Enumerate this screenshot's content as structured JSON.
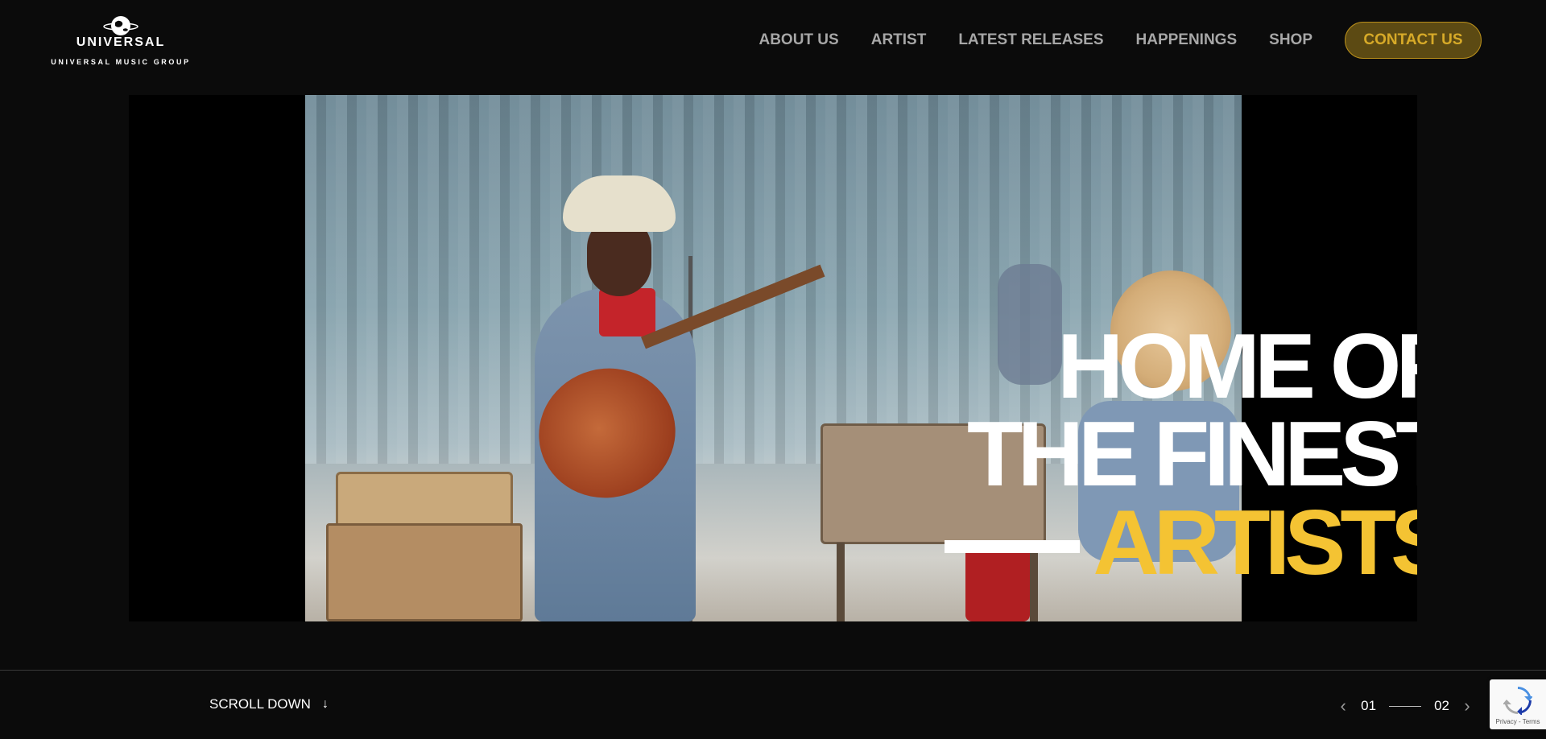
{
  "brand": {
    "logo_word": "UNIVERSAL",
    "logo_sub": "UNIVERSAL MUSIC GROUP",
    "logo_icon": "globe-icon"
  },
  "nav": {
    "items": [
      {
        "label": "ABOUT US"
      },
      {
        "label": "ARTIST"
      },
      {
        "label": "LATEST RELEASES"
      },
      {
        "label": "HAPPENINGS"
      },
      {
        "label": "SHOP"
      }
    ],
    "contact_label": "CONTACT US"
  },
  "hero": {
    "line1": "HOME OF",
    "line2": "THE FINEST",
    "line3": "ARTISTS"
  },
  "footer": {
    "scroll_label": "SCROLL DOWN",
    "pager_current": "01",
    "pager_total": "02",
    "recaptcha_links": "Privacy - Terms"
  },
  "colors": {
    "accent": "#f4c333",
    "contact_bg": "#5c4a13",
    "contact_text": "#d7aa28",
    "background": "#0b0b0b"
  }
}
